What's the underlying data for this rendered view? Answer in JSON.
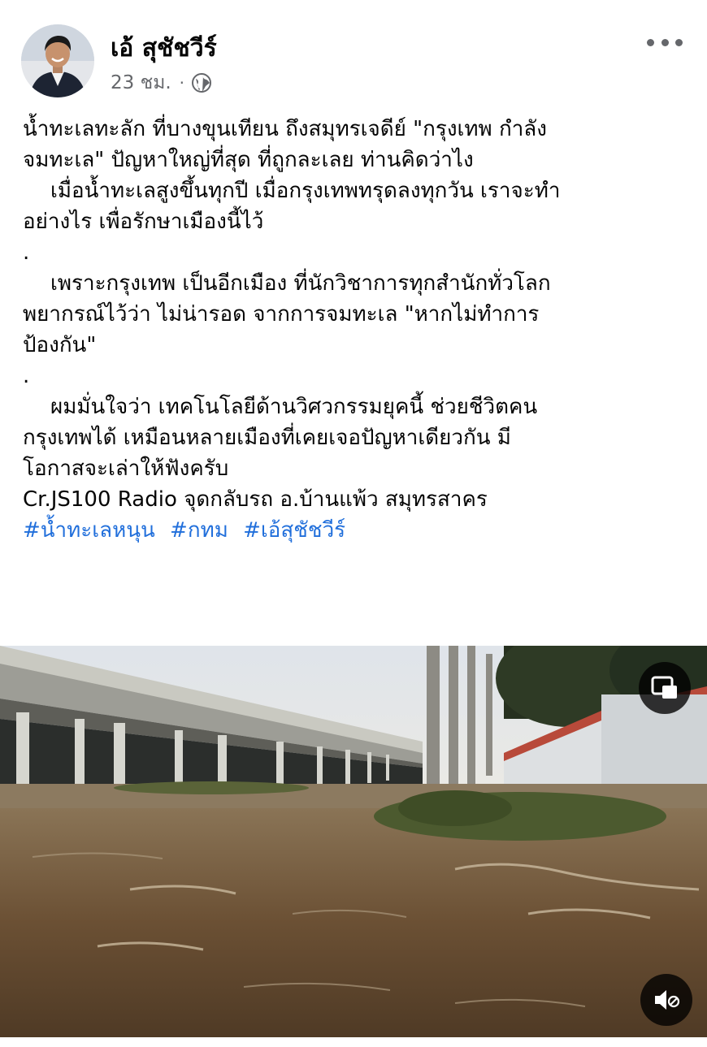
{
  "post": {
    "author": "เอ้ สุชัชวีร์",
    "time": "23 ชม.",
    "separator": "·",
    "privacy_icon": "globe-icon",
    "more_icon": "more-options-icon",
    "lines": [
      "น้ำทะเลทะลัก ที่บางขุนเทียน ถึงสมุทรเจดีย์  \"กรุงเทพ กำลัง",
      "จมทะเล\" ปัญหาใหญ่ที่สุด ที่ถูกละเลย ท่านคิดว่าไง",
      "เมื่อน้ำทะเลสูงขึ้นทุกปี เมื่อกรุงเทพทรุดลงทุกวัน เราจะทำ",
      "อย่างไร เพื่อรักษาเมืองนี้ไว้",
      ".",
      "เพราะกรุงเทพ เป็นอีกเมือง ที่นักวิชาการทุกสำนักทั่วโลก",
      "พยากรณ์ไว้ว่า ไม่น่ารอด จากการจมทะเล \"หากไม่ทำการ",
      "ป้องกัน\"",
      ".",
      "ผมมั่นใจว่า เทคโนโลยีด้านวิศวกรรมยุคนี้ ช่วยชีวิตคน",
      "กรุงเทพได้ เหมือนหลายเมืองที่เคยเจอปัญหาเดียวกัน มี",
      "โอกาสจะเล่าให้ฟังครับ",
      "Cr.JS100 Radio จุดกลับรถ อ.บ้านแพ้ว สมุทรสาคร"
    ],
    "hashtags": [
      "#น้ำทะเลหนุน",
      "#กทม",
      "#เอ้สุชัชวีร์"
    ]
  },
  "media": {
    "pip_icon": "picture-in-picture-icon",
    "mute_icon": "muted-speaker-icon"
  },
  "colors": {
    "text": "#050505",
    "secondary": "#65676b",
    "link": "#216fdb"
  }
}
